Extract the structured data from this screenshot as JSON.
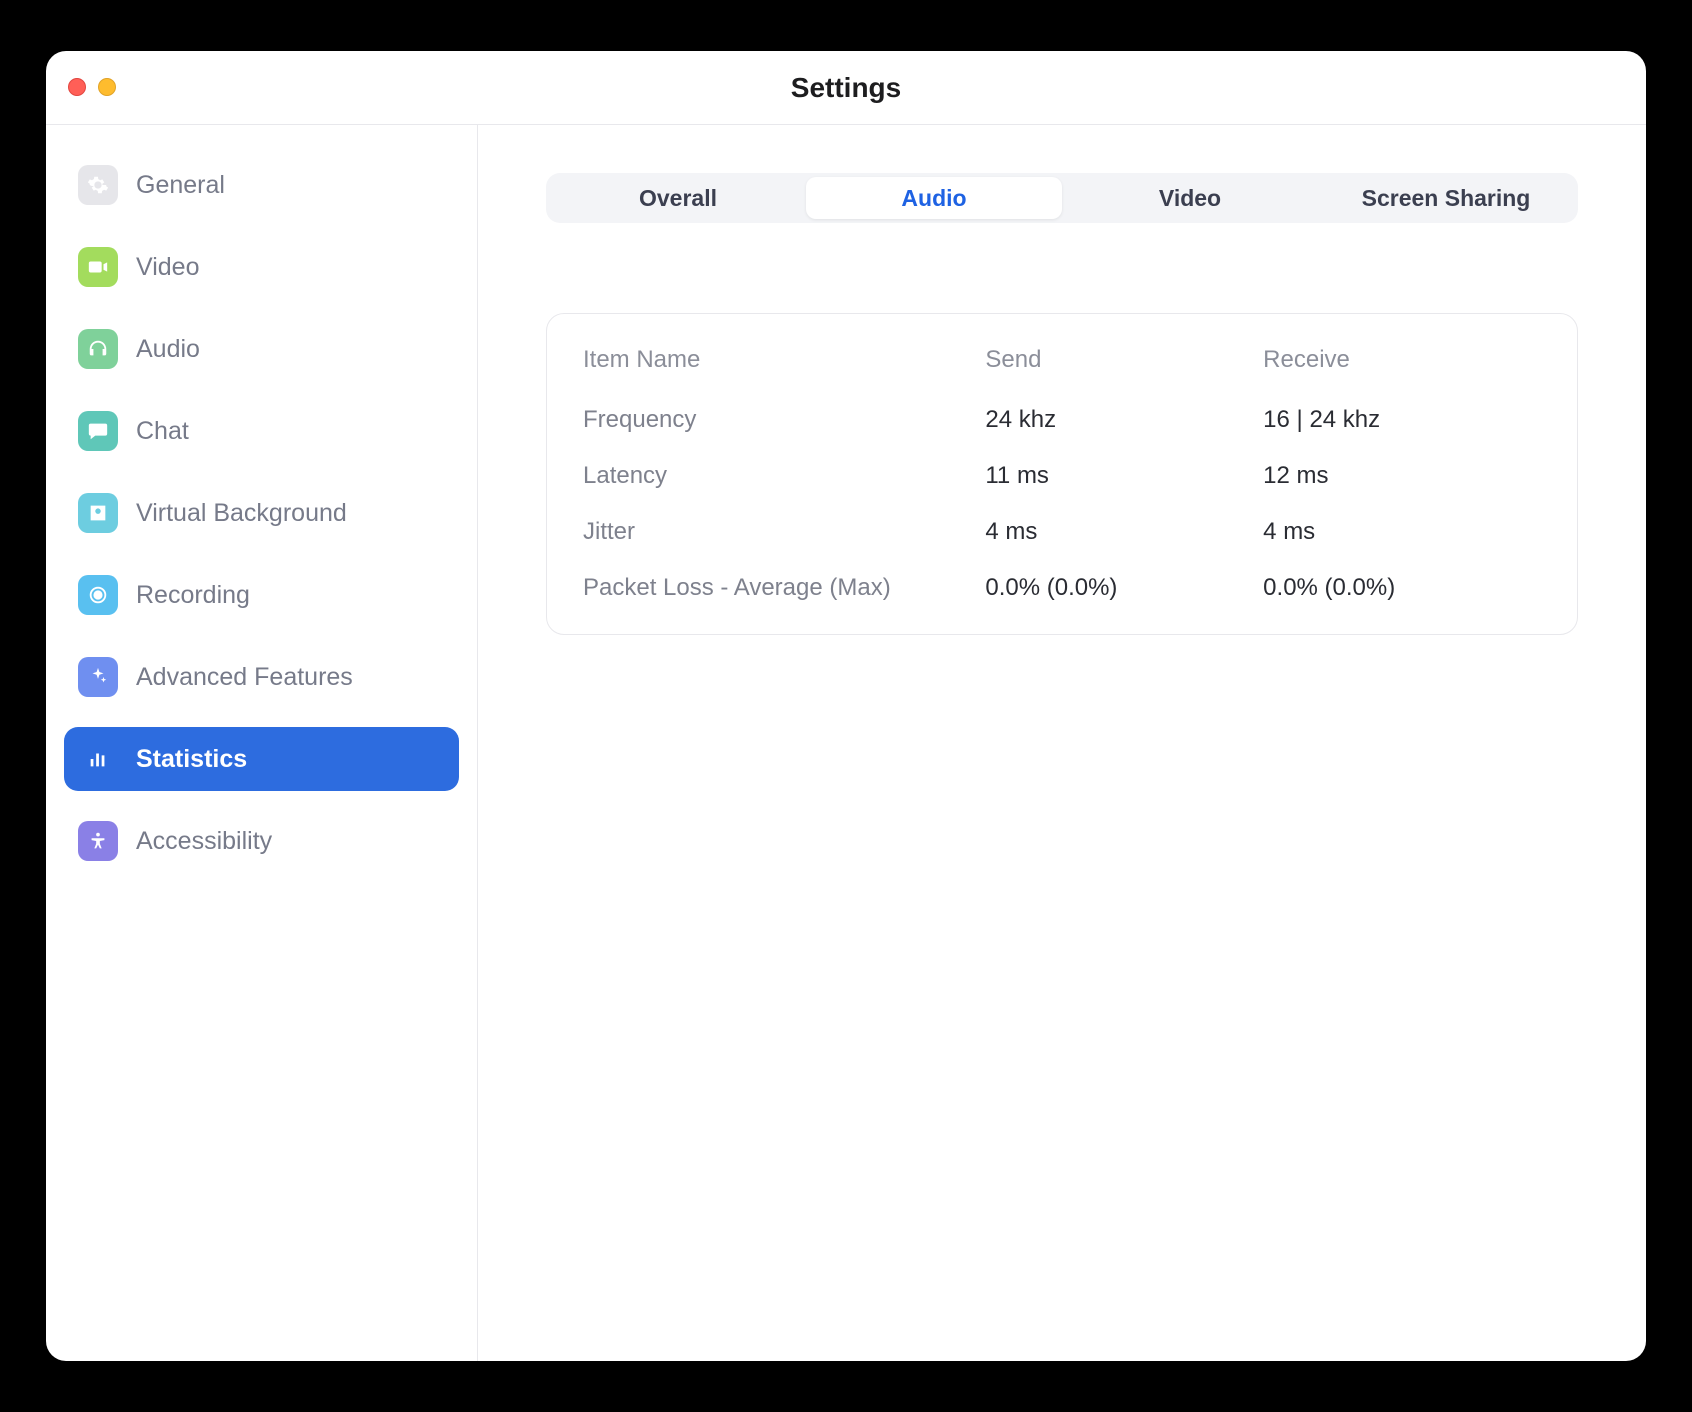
{
  "window": {
    "title": "Settings"
  },
  "sidebar": {
    "items": [
      {
        "label": "General"
      },
      {
        "label": "Video"
      },
      {
        "label": "Audio"
      },
      {
        "label": "Chat"
      },
      {
        "label": "Virtual Background"
      },
      {
        "label": "Recording"
      },
      {
        "label": "Advanced Features"
      },
      {
        "label": "Statistics"
      },
      {
        "label": "Accessibility"
      }
    ],
    "active_index": 7
  },
  "tabs": {
    "items": [
      {
        "label": "Overall"
      },
      {
        "label": "Audio"
      },
      {
        "label": "Video"
      },
      {
        "label": "Screen Sharing"
      }
    ],
    "active_index": 1
  },
  "stats_table": {
    "headers": {
      "name": "Item Name",
      "send": "Send",
      "receive": "Receive"
    },
    "rows": [
      {
        "name": "Frequency",
        "send": "24 khz",
        "receive": "16 | 24 khz"
      },
      {
        "name": "Latency",
        "send": "11 ms",
        "receive": "12 ms"
      },
      {
        "name": "Jitter",
        "send": "4 ms",
        "receive": "4 ms"
      },
      {
        "name": "Packet Loss - Average (Max)",
        "send": "0.0% (0.0%)",
        "receive": "0.0% (0.0%)"
      }
    ]
  }
}
